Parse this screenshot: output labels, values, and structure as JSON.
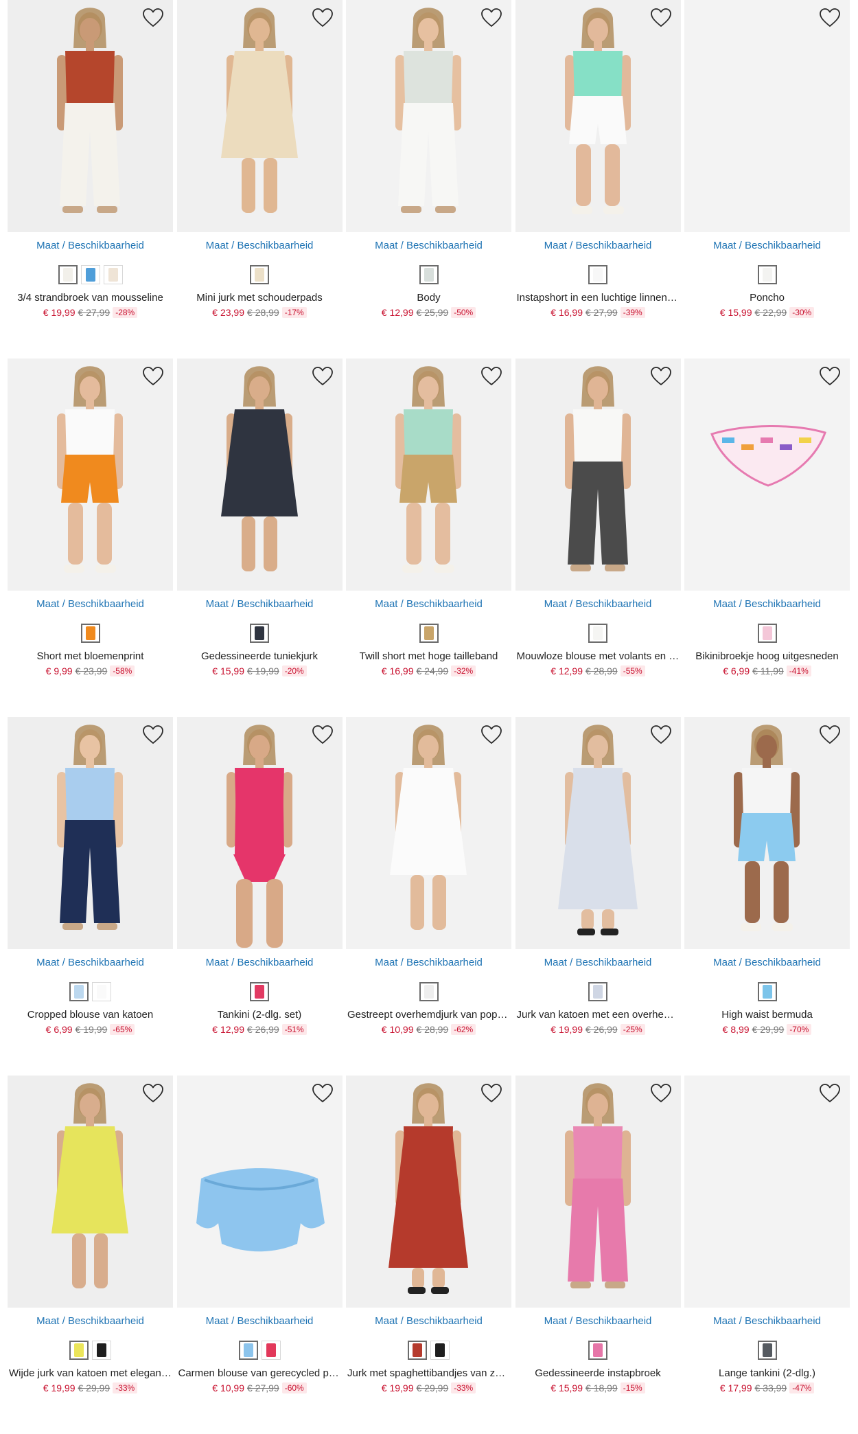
{
  "size_link_label": "Maat / Beschikbaarheid",
  "products": [
    {
      "name": "3/4 strandbroek van mousseline",
      "price": "€ 19,99",
      "old_price": "€ 27,99",
      "discount": "-28%",
      "swatches": [
        "#f2f0ea",
        "#4f9ed9",
        "#efe4d6"
      ],
      "selected": 0,
      "photo": {
        "bg": "#eeeeee",
        "top": "#b5462c",
        "bottom": "#f4f2ec",
        "skin": "#c99a76",
        "type": "pants"
      }
    },
    {
      "name": "Mini jurk met schouderpads",
      "price": "€ 23,99",
      "old_price": "€ 28,99",
      "discount": "-17%",
      "swatches": [
        "#ece0c8"
      ],
      "selected": 0,
      "photo": {
        "bg": "#f0f0f0",
        "top": "#ecdcbe",
        "bottom": "#ecdcbe",
        "skin": "#e0b792",
        "type": "dress"
      }
    },
    {
      "name": "Body",
      "price": "€ 12,99",
      "old_price": "€ 25,99",
      "discount": "-50%",
      "swatches": [
        "#d8dfdc"
      ],
      "selected": 0,
      "photo": {
        "bg": "#f2f2f2",
        "top": "#dde3dd",
        "bottom": "#f7f7f5",
        "skin": "#e6c0a0",
        "type": "pants"
      }
    },
    {
      "name": "Instapshort in een luchtige linnenmix",
      "price": "€ 16,99",
      "old_price": "€ 27,99",
      "discount": "-39%",
      "swatches": [
        "#f7f7f7"
      ],
      "selected": 0,
      "photo": {
        "bg": "#f0f0f0",
        "top": "#86e0c6",
        "bottom": "#fafafa",
        "skin": "#e2b99b",
        "type": "shorts"
      }
    },
    {
      "name": "Poncho",
      "price": "€ 15,99",
      "old_price": "€ 22,99",
      "discount": "-30%",
      "swatches": [
        "#f3f3f1"
      ],
      "selected": 0,
      "photo": {
        "bg": "#f3f3f3",
        "top": "#f3f3f3",
        "bottom": "#f3f3f3",
        "skin": "#f3f3f3",
        "type": "empty"
      }
    },
    {
      "name": "Short met bloemenprint",
      "price": "€ 9,99",
      "old_price": "€ 23,99",
      "discount": "-58%",
      "swatches": [
        "#f08a1e"
      ],
      "selected": 0,
      "photo": {
        "bg": "#f1f1f1",
        "top": "#fafafa",
        "bottom": "#f08a1e",
        "skin": "#e4bb9c",
        "type": "shorts"
      }
    },
    {
      "name": "Gedessineerde tuniekjurk",
      "price": "€ 15,99",
      "old_price": "€ 19,99",
      "discount": "-20%",
      "swatches": [
        "#2f3440"
      ],
      "selected": 0,
      "photo": {
        "bg": "#f0f0f0",
        "top": "#2f3440",
        "bottom": "#3b4150",
        "skin": "#d9ad8a",
        "type": "dress"
      }
    },
    {
      "name": "Twill short met hoge tailleband",
      "price": "€ 16,99",
      "old_price": "€ 24,99",
      "discount": "-32%",
      "swatches": [
        "#c9a56a"
      ],
      "selected": 0,
      "photo": {
        "bg": "#f1f1f1",
        "top": "#a8dcc8",
        "bottom": "#c9a56a",
        "skin": "#e4bd9f",
        "type": "shorts"
      }
    },
    {
      "name": "Mouwloze blouse met volants en st…",
      "price": "€ 12,99",
      "old_price": "€ 28,99",
      "discount": "-55%",
      "swatches": [
        "#f5f5f3"
      ],
      "selected": 0,
      "photo": {
        "bg": "#f0f0f0",
        "top": "#f8f8f6",
        "bottom": "#4b4b4b",
        "skin": "#e0b595",
        "type": "pants"
      }
    },
    {
      "name": "Bikinibroekje hoog uitgesneden",
      "price": "€ 6,99",
      "old_price": "€ 11,99",
      "discount": "-41%",
      "swatches": [
        "#f4c7d8"
      ],
      "selected": 0,
      "photo": {
        "bg": "#f3f3f3",
        "top": "#f3f3f3",
        "bottom": "#e67ab0",
        "skin": "#f3f3f3",
        "type": "bikini"
      }
    },
    {
      "name": "Cropped blouse van katoen",
      "price": "€ 6,99",
      "old_price": "€ 19,99",
      "discount": "-65%",
      "swatches": [
        "#bcd8ef",
        "#fafafa"
      ],
      "selected": 0,
      "photo": {
        "bg": "#eeeeee",
        "top": "#a9cdee",
        "bottom": "#1f2f56",
        "skin": "#e8c3a3",
        "type": "pants"
      }
    },
    {
      "name": "Tankini (2-dlg. set)",
      "price": "€ 12,99",
      "old_price": "€ 26,99",
      "discount": "-51%",
      "swatches": [
        "#e23a62"
      ],
      "selected": 0,
      "photo": {
        "bg": "#f0f0f0",
        "top": "#e5356a",
        "bottom": "#e5356a",
        "skin": "#d8a987",
        "type": "swim"
      }
    },
    {
      "name": "Gestreept overhemdjurk van popel…",
      "price": "€ 10,99",
      "old_price": "€ 28,99",
      "discount": "-62%",
      "swatches": [
        "#eeeeee"
      ],
      "selected": 0,
      "photo": {
        "bg": "#f2f2f2",
        "top": "#fbfbfb",
        "bottom": "#fbfbfb",
        "skin": "#e2bb9b",
        "type": "dress"
      }
    },
    {
      "name": "Jurk van katoen met een overhemd…",
      "price": "€ 19,99",
      "old_price": "€ 26,99",
      "discount": "-25%",
      "swatches": [
        "#cfd6e4"
      ],
      "selected": 0,
      "photo": {
        "bg": "#f0f0f0",
        "top": "#d9dfea",
        "bottom": "#d9dfea",
        "skin": "#e2bd9f",
        "type": "longdress"
      }
    },
    {
      "name": "High waist bermuda",
      "price": "€ 8,99",
      "old_price": "€ 29,99",
      "discount": "-70%",
      "swatches": [
        "#7cc4ea"
      ],
      "selected": 0,
      "photo": {
        "bg": "#f1f1f1",
        "top": "#f5f5f5",
        "bottom": "#8ccbef",
        "skin": "#9c6a4c",
        "type": "shorts"
      }
    },
    {
      "name": "Wijde jurk van katoen met elegant…",
      "price": "€ 19,99",
      "old_price": "€ 29,99",
      "discount": "-33%",
      "swatches": [
        "#ebe55a",
        "#1e1e1e"
      ],
      "selected": 0,
      "photo": {
        "bg": "#eeeeee",
        "top": "#e6e45c",
        "bottom": "#e6e45c",
        "skin": "#d8ad8d",
        "type": "dress"
      }
    },
    {
      "name": "Carmen blouse van gerecycled poly…",
      "price": "€ 10,99",
      "old_price": "€ 27,99",
      "discount": "-60%",
      "swatches": [
        "#8cc4ec",
        "#e2385a"
      ],
      "selected": 0,
      "photo": {
        "bg": "#f3f3f3",
        "top": "#8ec5ee",
        "bottom": "#f3f3f3",
        "skin": "#f3f3f3",
        "type": "blouse"
      }
    },
    {
      "name": "Jurk met spaghettibandjes van zac…",
      "price": "€ 19,99",
      "old_price": "€ 29,99",
      "discount": "-33%",
      "swatches": [
        "#b53b2e",
        "#1e1e1e"
      ],
      "selected": 0,
      "photo": {
        "bg": "#f0f0f0",
        "top": "#b53a2c",
        "bottom": "#b53a2c",
        "skin": "#e0b796",
        "type": "longdress"
      }
    },
    {
      "name": "Gedessineerde instapbroek",
      "price": "€ 15,99",
      "old_price": "€ 18,99",
      "discount": "-15%",
      "swatches": [
        "#e676a8"
      ],
      "selected": 0,
      "photo": {
        "bg": "#f0f0f0",
        "top": "#e989b4",
        "bottom": "#e77aab",
        "skin": "#deb393",
        "type": "pants"
      }
    },
    {
      "name": "Lange tankini (2-dlg.)",
      "price": "€ 17,99",
      "old_price": "€ 33,99",
      "discount": "-47%",
      "swatches": [
        "#555a60"
      ],
      "selected": 0,
      "photo": {
        "bg": "#f3f3f3",
        "top": "#f3f3f3",
        "bottom": "#f3f3f3",
        "skin": "#f3f3f3",
        "type": "empty"
      }
    }
  ]
}
